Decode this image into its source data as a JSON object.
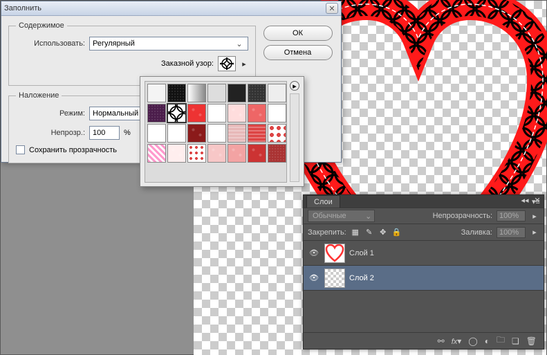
{
  "dialog": {
    "title": "Заполнить",
    "ok": "ОК",
    "cancel": "Отмена",
    "content": {
      "legend": "Содержимое",
      "use_label": "Использовать:",
      "use_value": "Регулярный",
      "pattern_label": "Заказной узор:"
    },
    "blend": {
      "legend": "Наложение",
      "mode_label": "Режим:",
      "mode_value": "Нормальный",
      "opacity_label": "Непрозр.:",
      "opacity_value": "100",
      "opacity_unit": "%",
      "preserve_label": "Сохранить прозрачность"
    }
  },
  "pattern_picker": {
    "columns": 7,
    "rows": 5,
    "selected_index": 8,
    "cells": [
      {
        "bg": "#f4f4f4"
      },
      {
        "bg": "#111",
        "pat": "noise"
      },
      {
        "bg": "#fff",
        "pat": "grad"
      },
      {
        "bg": "#ddd"
      },
      {
        "bg": "#222"
      },
      {
        "bg": "#333",
        "pat": "noise"
      },
      {
        "bg": "#eee"
      },
      {
        "bg": "#4b1d4b",
        "pat": "noise"
      },
      {
        "bg": "#fff",
        "pat": "rings"
      },
      {
        "bg": "#e33",
        "pat": "hearts"
      },
      {
        "bg": "#fff",
        "pat": "hearts"
      },
      {
        "bg": "#fdd",
        "pat": "hearts"
      },
      {
        "bg": "#e66",
        "pat": "hearts"
      },
      {
        "bg": "#fff",
        "pat": "hearts"
      },
      {
        "bg": "#fff",
        "pat": "hearts"
      },
      {
        "bg": "#fff",
        "pat": "hearts"
      },
      {
        "bg": "#8b1a1a",
        "pat": "hearts"
      },
      {
        "bg": "#fff",
        "pat": "hearts"
      },
      {
        "bg": "#e7b8b8",
        "pat": "stripes"
      },
      {
        "bg": "#d44",
        "pat": "stripes"
      },
      {
        "bg": "#fff",
        "pat": "swirl"
      },
      {
        "bg": "#fff",
        "pat": "pink"
      },
      {
        "bg": "#fee",
        "pat": "hearts"
      },
      {
        "bg": "#fff",
        "pat": "ornate"
      },
      {
        "bg": "#f7c7c7",
        "pat": "hearts"
      },
      {
        "bg": "#f3a3a3",
        "pat": "hearts"
      },
      {
        "bg": "#c33",
        "pat": "hearts"
      },
      {
        "bg": "#a33",
        "pat": "noise"
      }
    ]
  },
  "layers_panel": {
    "tab": "Слои",
    "blend_mode": "Обычные",
    "opacity_label": "Непрозрачность:",
    "opacity_value": "100%",
    "lock_label": "Закрепить:",
    "fill_label": "Заливка:",
    "fill_value": "100%",
    "layers": [
      {
        "name": "Слой 1",
        "selected": false,
        "thumb": "heart"
      },
      {
        "name": "Слой 2",
        "selected": true,
        "thumb": "checker"
      }
    ]
  }
}
